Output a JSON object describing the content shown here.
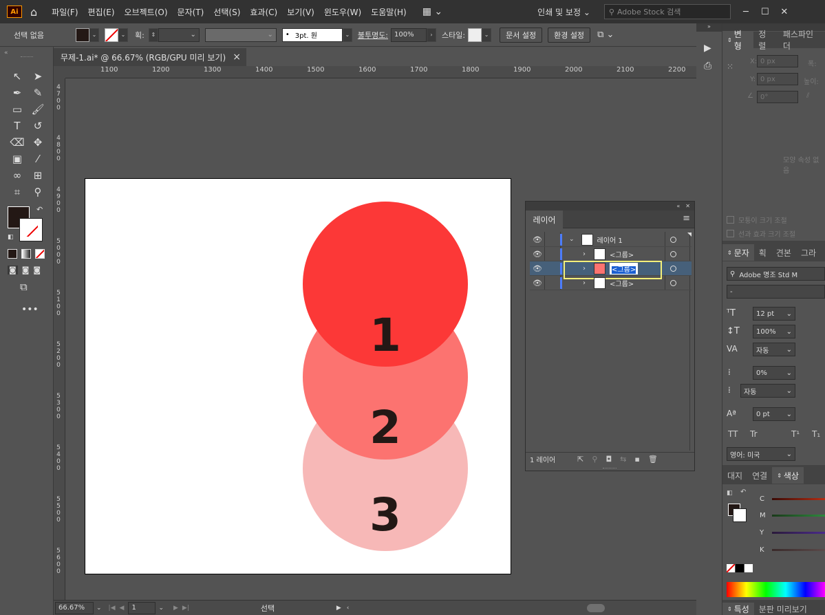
{
  "app": {
    "logo": "Ai"
  },
  "menu": [
    "파일(F)",
    "편집(E)",
    "오브젝트(O)",
    "문자(T)",
    "선택(S)",
    "효과(C)",
    "보기(V)",
    "윈도우(W)",
    "도움말(H)"
  ],
  "workspace": "인쇄 및 보정",
  "search": {
    "placeholder": "Adobe Stock 검색"
  },
  "window_buttons": [
    "─",
    "☐",
    "✕"
  ],
  "control": {
    "selection_status": "선택 없음",
    "stroke_label": "획:",
    "brush": "3pt. 원",
    "opacity_label": "불투명도:",
    "opacity_value": "100%",
    "style_label": "스타일:",
    "doc_setup": "문서 설정",
    "preferences": "환경 설정"
  },
  "document": {
    "tab": "무제-1.ai* @ 66.67% (RGB/GPU 미리 보기)",
    "close": "×"
  },
  "ruler": {
    "top": [
      "1100",
      "1200",
      "1300",
      "1400",
      "1500",
      "1600",
      "1700",
      "1800",
      "1900",
      "2000",
      "2100",
      "2200"
    ],
    "left": [
      "4700",
      "4800",
      "4900",
      "5000",
      "5100",
      "5200",
      "5300",
      "5400",
      "5500",
      "5600"
    ]
  },
  "artboard": {
    "circles": [
      {
        "label": "3",
        "color": "#f7b8b7"
      },
      {
        "label": "2",
        "color": "#fc7370"
      },
      {
        "label": "1",
        "color": "#fc3837"
      }
    ]
  },
  "status": {
    "zoom": "66.67%",
    "page": "1",
    "tool": "선택"
  },
  "layers_panel": {
    "title": "레이어",
    "rows": [
      {
        "name": "레이어 1"
      },
      {
        "name": "<그룹>"
      },
      {
        "name": "<그룹>"
      },
      {
        "name": "<그룹>"
      }
    ],
    "footer": "1 레이어"
  },
  "transform_panel": {
    "tabs": [
      "변형",
      "정렬",
      "패스파인더"
    ],
    "x": "0 px",
    "y": "0 px",
    "w_label": "폭:",
    "h_label": "높이:",
    "angle": "0°",
    "x_label": "X:",
    "y_label": "Y:",
    "empty_msg": "모양 속성 없음",
    "scale_corners": "모퉁이 크기 조절",
    "scale_strokes": "선과 효과 크기 조절"
  },
  "type_panel": {
    "tabs": [
      "문자",
      "획",
      "견본",
      "그라"
    ],
    "font": "Adobe 명조 Std M",
    "style": "-",
    "size": "12 pt",
    "leading": "100%",
    "kerning": "자동",
    "tracking": "0%",
    "auto_label": "자동",
    "baseline": "0 pt",
    "language": "영어: 미국"
  },
  "color_panel": {
    "tabs": [
      "대지",
      "연결",
      "색상"
    ],
    "channels": [
      "C",
      "M",
      "Y",
      "K"
    ]
  },
  "bottom_tabs": [
    "특성",
    "분판 미리보기"
  ]
}
